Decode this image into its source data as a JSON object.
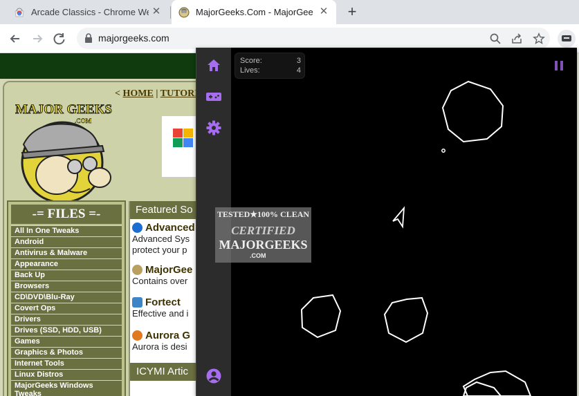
{
  "browser": {
    "tabs": [
      {
        "title": "Arcade Classics - Chrome Web S",
        "active": false
      },
      {
        "title": "MajorGeeks.Com - MajorGeeks",
        "active": true
      }
    ],
    "url": "majorgeeks.com"
  },
  "site": {
    "top_links": [
      "HOME",
      "TUTORI"
    ],
    "files_header": "-= FILES =-",
    "files": [
      "All In One Tweaks",
      "Android",
      "Antivirus & Malware",
      "Appearance",
      "Back Up",
      "Browsers",
      "CD\\DVD\\Blu-Ray",
      "Covert Ops",
      "Drivers",
      "Drives (SSD, HDD, USB)",
      "Games",
      "Graphics & Photos",
      "Internet Tools",
      "Linux Distros",
      "MajorGeeks Windows Tweaks"
    ],
    "featured_header": "Featured So",
    "featured": [
      {
        "title": "Advanced",
        "desc": [
          "Advanced Sys",
          "protect your p"
        ]
      },
      {
        "title": "MajorGee",
        "desc": [
          "Contains over"
        ]
      },
      {
        "title": "Fortect",
        "desc": [
          "Effective and i"
        ]
      },
      {
        "title": "Aurora G",
        "desc": [
          "Aurora is desi"
        ]
      }
    ],
    "icymi_header": "ICYMI Artic",
    "logo_text": "MAJOR GEEKS",
    "logo_sub": ".COM"
  },
  "game": {
    "score_label": "Score:",
    "score": "3",
    "lives_label": "Lives:",
    "lives": "4",
    "sidebar_icons": [
      "home-icon",
      "gamepad-icon",
      "gear-icon",
      "account-icon"
    ],
    "accent": "#a66df0"
  },
  "seal": {
    "line1": "TESTED★100% CLEAN",
    "line2": "CERTIFIED",
    "line3": "MAJORGEEKS",
    "line4": ".COM"
  }
}
